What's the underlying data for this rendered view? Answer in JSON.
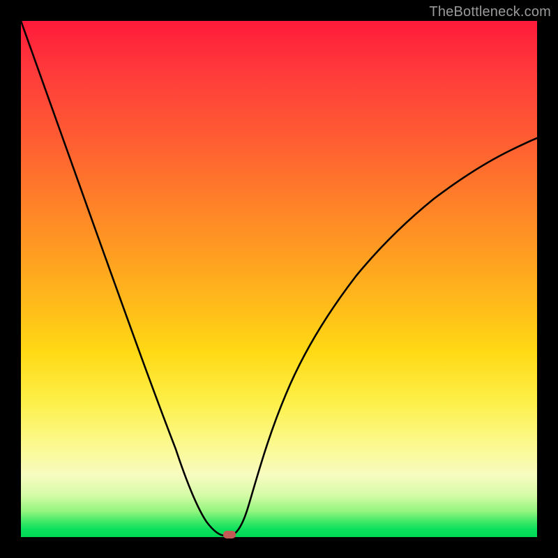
{
  "watermark": "TheBottleneck.com",
  "chart_data": {
    "type": "line",
    "title": "",
    "xlabel": "",
    "ylabel": "",
    "xlim": [
      0,
      100
    ],
    "ylim": [
      0,
      100
    ],
    "grid": false,
    "legend": false,
    "series": [
      {
        "name": "bottleneck-curve",
        "x": [
          0,
          5,
          10,
          15,
          20,
          25,
          30,
          33,
          36,
          38,
          39,
          40,
          41,
          42,
          44,
          48,
          55,
          62,
          70,
          78,
          86,
          94,
          100
        ],
        "y": [
          100,
          86,
          72,
          58,
          44,
          30,
          17,
          9,
          3,
          0.6,
          0.2,
          0.2,
          0.8,
          2,
          6,
          14,
          27,
          38,
          49,
          58,
          66,
          72,
          76
        ]
      }
    ],
    "marker": {
      "x_percent": 40,
      "y_percent": 0.3,
      "color": "#c45a55",
      "shape": "rounded-rect"
    },
    "gradient_stops": [
      {
        "pct": 0,
        "color": "#ff1a3a"
      },
      {
        "pct": 25,
        "color": "#ff6a2d"
      },
      {
        "pct": 50,
        "color": "#ffbe1a"
      },
      {
        "pct": 75,
        "color": "#fdf15a"
      },
      {
        "pct": 92,
        "color": "#d4fba6"
      },
      {
        "pct": 100,
        "color": "#00d856"
      }
    ]
  }
}
